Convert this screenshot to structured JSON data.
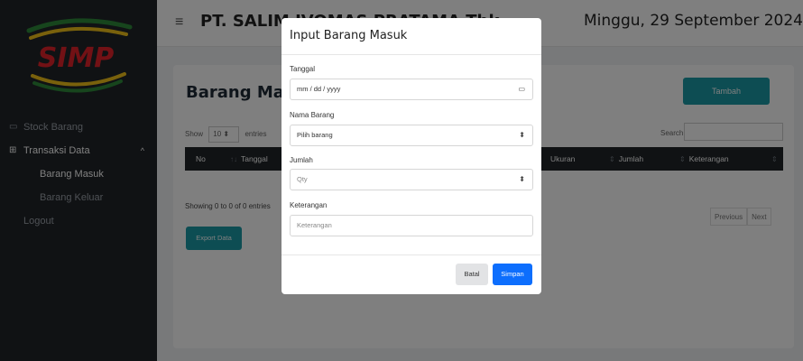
{
  "brand": {
    "logo_text": "SIMP"
  },
  "sidebar": {
    "items": [
      {
        "label": "Stock Barang",
        "icon": "box-icon"
      },
      {
        "label": "Transaksi Data",
        "icon": "table-icon"
      },
      {
        "label": "Barang Masuk"
      },
      {
        "label": "Barang Keluar"
      },
      {
        "label": "Logout"
      }
    ]
  },
  "header": {
    "company": "PT. SALIM IVOMAS PRATAMA Tbk",
    "date": "Minggu, 29 September 2024"
  },
  "page": {
    "title": "Barang Masuk",
    "add_label": "Tambah",
    "show_label": "Show",
    "show_value": "10",
    "entries_label": "entries",
    "search_label": "Search:",
    "columns": [
      "No",
      "Tanggal",
      "Ukuran",
      "Jumlah",
      "Keterangan"
    ],
    "info": "Showing 0 to 0 of 0 entries",
    "prev_label": "Previous",
    "next_label": "Next",
    "export_label": "Export Data"
  },
  "modal": {
    "title": "Input Barang Masuk",
    "fields": {
      "tanggal": {
        "label": "Tanggal",
        "placeholder": "mm / dd / yyyy"
      },
      "nama_barang": {
        "label": "Nama Barang",
        "value": "Pilih barang"
      },
      "jumlah": {
        "label": "Jumlah",
        "placeholder": "Qty"
      },
      "keterangan": {
        "label": "Keterangan",
        "placeholder": "Keterangan"
      }
    },
    "cancel_label": "Batal",
    "save_label": "Simpan"
  },
  "colors": {
    "sidebar_bg": "#212529",
    "accent_teal": "#1a9aa7",
    "primary_blue": "#0d6efd",
    "logo_red": "#e4232a",
    "logo_yellow": "#f2c318",
    "logo_green": "#2e8b3a"
  }
}
